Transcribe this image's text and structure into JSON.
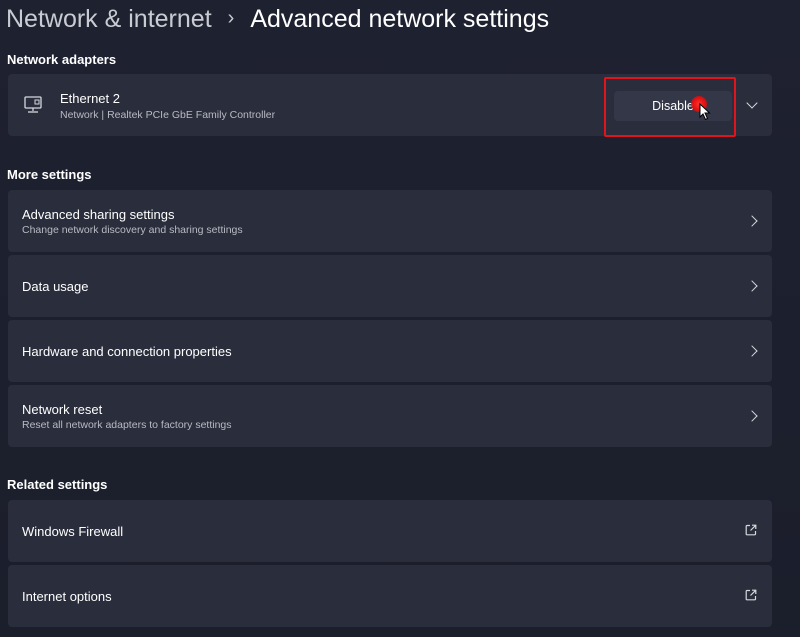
{
  "breadcrumb": {
    "parent": "Network & internet",
    "separator": "›",
    "current": "Advanced network settings"
  },
  "sections": {
    "network_adapters": "Network adapters",
    "more_settings": "More settings",
    "related_settings": "Related settings"
  },
  "adapter": {
    "icon": "ethernet-adapter-icon",
    "name": "Ethernet 2",
    "description": "Network | Realtek PCIe GbE Family Controller",
    "button_label": "Disable"
  },
  "more_settings": [
    {
      "label": "Advanced sharing settings",
      "sublabel": "Change network discovery and sharing settings",
      "icon": "chevron-right-icon"
    },
    {
      "label": "Data usage",
      "icon": "chevron-right-icon"
    },
    {
      "label": "Hardware and connection properties",
      "icon": "chevron-right-icon"
    },
    {
      "label": "Network reset",
      "sublabel": "Reset all network adapters to factory settings",
      "icon": "chevron-right-icon"
    }
  ],
  "related_settings": [
    {
      "label": "Windows Firewall",
      "icon": "external-link-icon"
    },
    {
      "label": "Internet options",
      "icon": "external-link-icon"
    }
  ],
  "colors": {
    "background": "#1c1f2b",
    "card": "#2a2d3b",
    "highlight": "#e0141c"
  }
}
